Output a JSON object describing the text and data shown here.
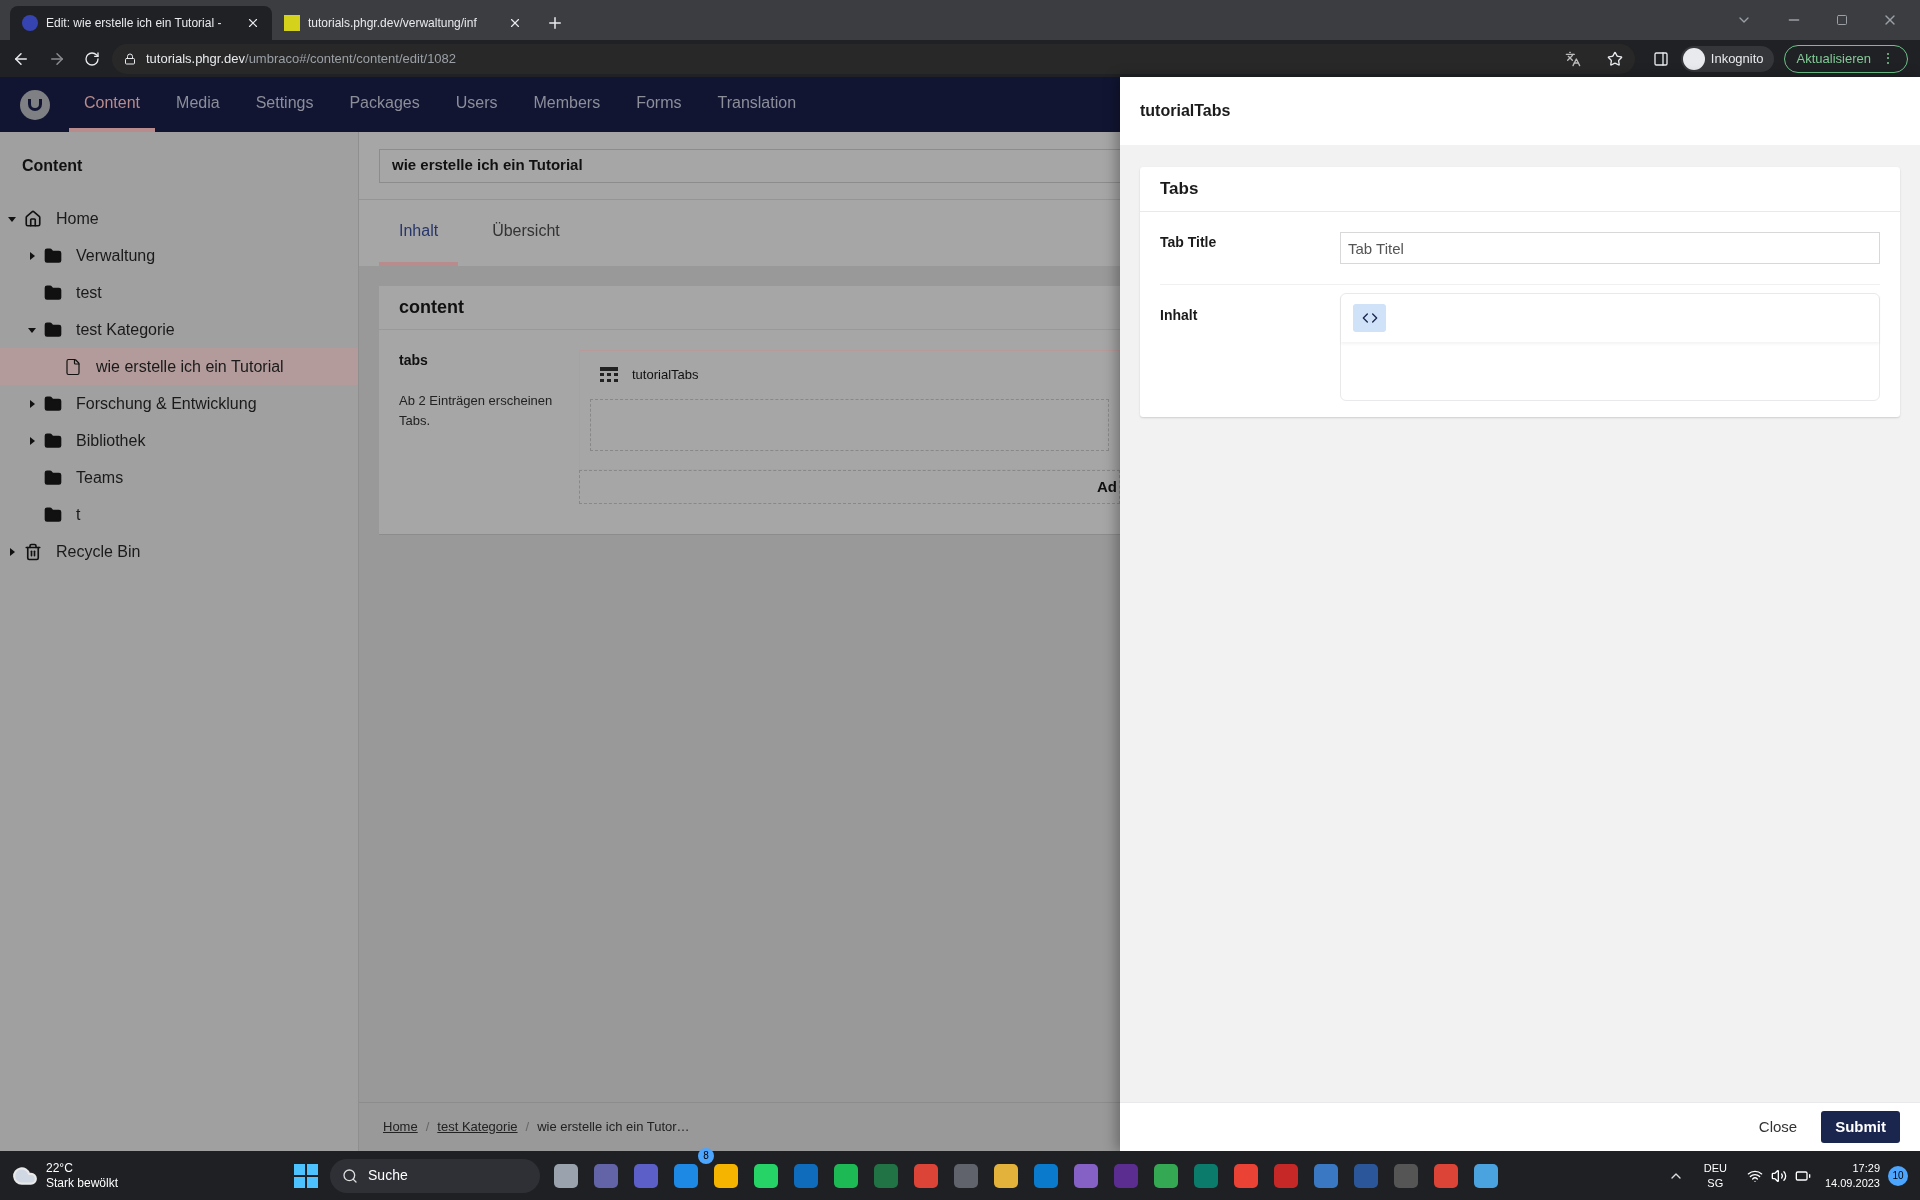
{
  "browser": {
    "tabs": [
      {
        "title": "Edit: wie erstelle ich ein Tutorial -",
        "selected": true
      },
      {
        "title": "tutorials.phgr.dev/verwaltung/inf",
        "selected": false
      }
    ],
    "url_host": "tutorials.phgr.dev",
    "url_path": "/umbraco#/content/content/edit/1082",
    "profile": "Inkognito",
    "update_button": "Aktualisieren",
    "update_menu": "⋮"
  },
  "nav": {
    "items": [
      {
        "label": "Content",
        "selected": true
      },
      {
        "label": "Media",
        "selected": false
      },
      {
        "label": "Settings",
        "selected": false
      },
      {
        "label": "Packages",
        "selected": false
      },
      {
        "label": "Users",
        "selected": false
      },
      {
        "label": "Members",
        "selected": false
      },
      {
        "label": "Forms",
        "selected": false
      },
      {
        "label": "Translation",
        "selected": false
      }
    ]
  },
  "sidebar": {
    "title": "Content",
    "tree": [
      {
        "label": "Home",
        "kind": "home",
        "expanded": true,
        "selected": false,
        "children": [
          {
            "label": "Verwaltung",
            "kind": "folder",
            "expanded": false,
            "selected": false
          },
          {
            "label": "test",
            "kind": "folder",
            "selected": false
          },
          {
            "label": "test Kategorie",
            "kind": "folder",
            "expanded": true,
            "selected": false,
            "children": [
              {
                "label": "wie erstelle ich ein Tutorial",
                "kind": "document",
                "selected": true
              }
            ]
          },
          {
            "label": "Forschung & Entwicklung",
            "kind": "folder",
            "expanded": false,
            "selected": false
          },
          {
            "label": "Bibliothek",
            "kind": "folder",
            "expanded": false,
            "selected": false
          },
          {
            "label": "Teams",
            "kind": "folder",
            "selected": false
          },
          {
            "label": "t",
            "kind": "folder",
            "selected": false
          }
        ]
      },
      {
        "label": "Recycle Bin",
        "kind": "trash",
        "expanded": false,
        "selected": false
      }
    ]
  },
  "editor": {
    "name": "wie erstelle ich ein Tutorial",
    "tabs": [
      {
        "label": "Inhalt",
        "selected": true
      },
      {
        "label": "Übersicht",
        "selected": false
      }
    ],
    "group_title": "content",
    "property_label": "tabs",
    "property_description": "Ab 2 Einträgen erscheinen Tabs.",
    "block_name": "tutorialTabs",
    "add_button": "Ad",
    "breadcrumb": [
      "Home",
      "test Kategorie",
      "wie erstelle ich ein Tutor…"
    ],
    "breadcrumb_separator": "/"
  },
  "dialog": {
    "title": "tutorialTabs",
    "card_title": "Tabs",
    "fields": [
      {
        "label": "Tab Title",
        "kind": "text",
        "placeholder": "Tab Titel"
      },
      {
        "label": "Inhalt",
        "kind": "code"
      }
    ],
    "close_button": "Close",
    "submit_button": "Submit"
  },
  "taskbar": {
    "temperature": "22°C",
    "weather": "Stark bewölkt",
    "search": "Suche",
    "badge": "8",
    "language": "DEU",
    "region": "SG",
    "time": "17:29",
    "date": "14.09.2023",
    "notifications": "10"
  }
}
